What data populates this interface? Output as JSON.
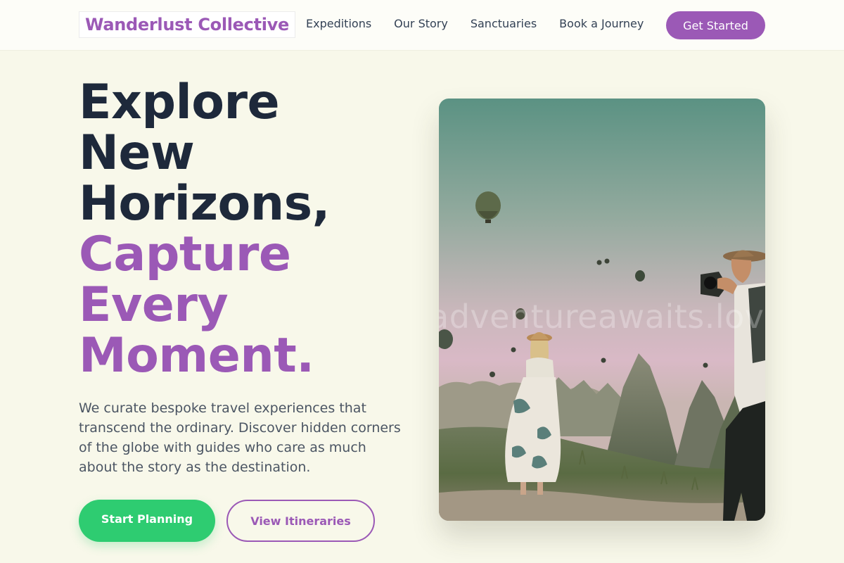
{
  "header": {
    "logo": "Wanderlust Collective",
    "nav": [
      "Expeditions",
      "Our Story",
      "Sanctuaries",
      "Book a Journey"
    ],
    "cta": "Get Started"
  },
  "hero": {
    "title_line1": "Explore",
    "title_line2": "New",
    "title_line3": "Horizons,",
    "title_line4": "Capture",
    "title_line5": "Every",
    "title_line6": "Moment.",
    "description": "We curate bespoke travel experiences that transcend the ordinary. Discover hidden corners of the globe with guides who care as much about the story as the destination.",
    "primary_button": "Start Planning",
    "secondary_button": "View Itineraries"
  },
  "image": {
    "watermark": "adventureawaits.love",
    "subject": "couple-photographing-hot-air-balloons"
  },
  "colors": {
    "brand_purple": "#9b59b6",
    "accent_green": "#2ecc71",
    "page_background": "#f8f8ea",
    "heading_dark": "#1e293b"
  }
}
